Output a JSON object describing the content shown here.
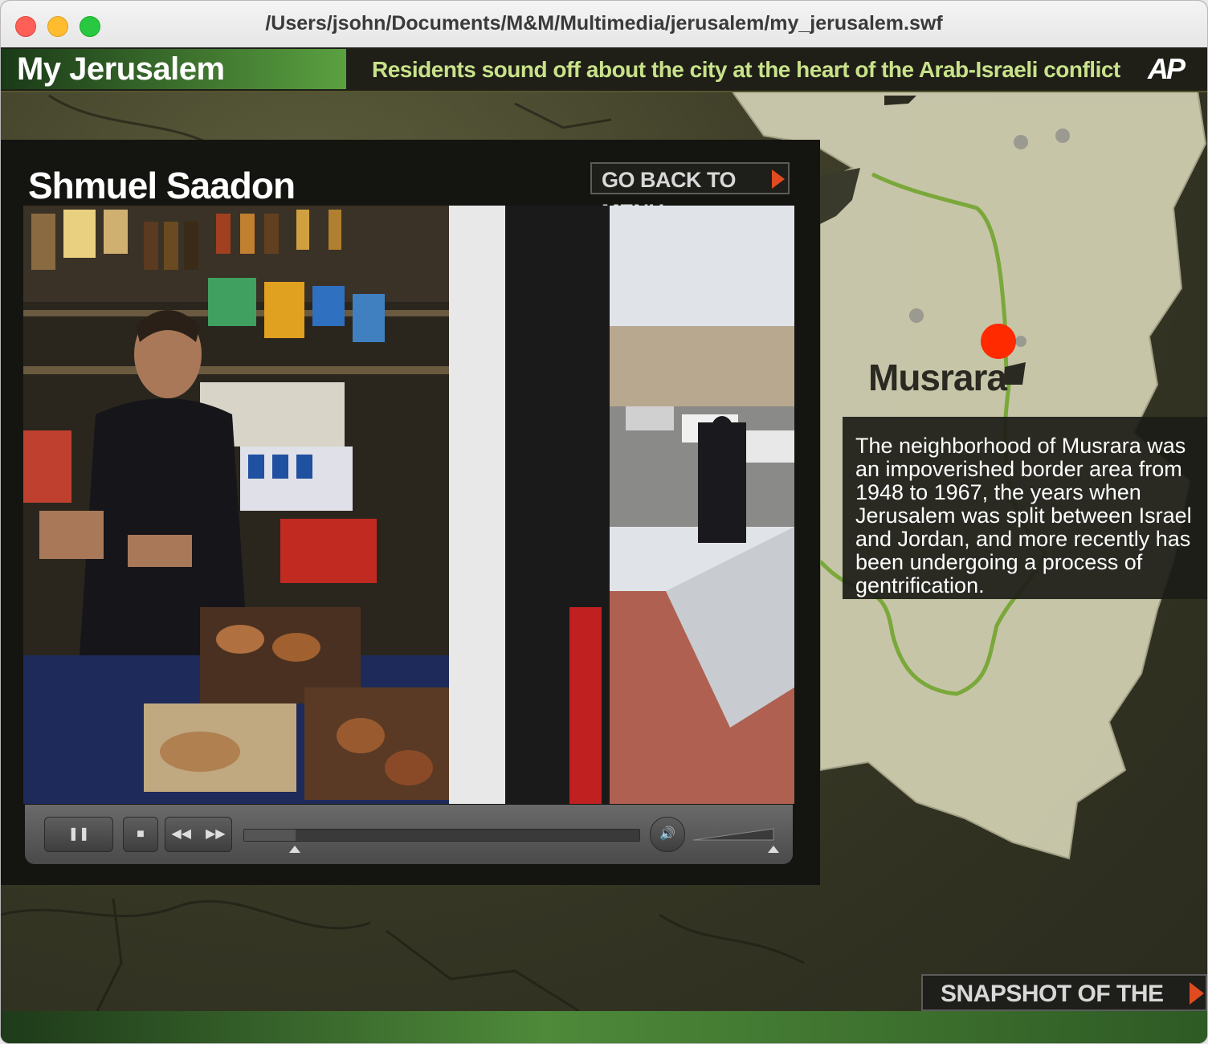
{
  "window": {
    "title": "/Users/jsohn/Documents/M&M/Multimedia/jerusalem/my_jerusalem.swf"
  },
  "header": {
    "app_title": "My Jerusalem",
    "tagline": "Residents sound off about the city at the heart of the Arab-Israeli conflict",
    "logo": "AP"
  },
  "panel": {
    "person_name": "Shmuel Saadon",
    "back_button": "GO BACK TO MENU"
  },
  "player": {
    "pause_icon": "pause-icon",
    "stop_icon": "stop-icon",
    "rewind_icon": "rewind-icon",
    "forward_icon": "fast-forward-icon",
    "volume_icon": "speaker-icon",
    "progress": 0.13,
    "volume": 1.0
  },
  "map": {
    "neighborhood": "Musrara",
    "description": "The neighborhood of Musrara was an impoverished border area from 1948 to 1967, the years when Jerusalem was split between Israel and Jordan, and more recently has been undergoing a process of gentrification.",
    "marker_color": "#ff2a00",
    "border_line_color": "#7aa83a"
  },
  "footer": {
    "snapshot_button": "SNAPSHOT OF THE CITY"
  },
  "colors": {
    "accent_green": "#5aa040",
    "tagline": "#c9e28a",
    "arrow": "#e04b20"
  }
}
